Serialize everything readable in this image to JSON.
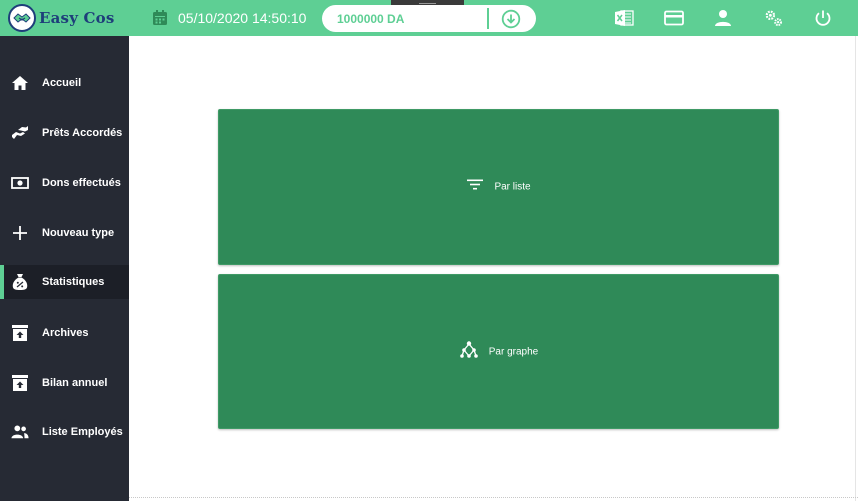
{
  "app": {
    "logo_text": "Easy Cos",
    "datetime": "05/10/2020 14:50:10",
    "balance": "1000000 DA"
  },
  "header_icons": [
    "excel-icon",
    "card-icon",
    "user-icon",
    "settings-icon",
    "power-icon"
  ],
  "sidebar": {
    "items": [
      {
        "label": "Accueil",
        "icon": "home-icon"
      },
      {
        "label": "Prêts Accordés",
        "icon": "loan-icon"
      },
      {
        "label": "Dons effectués",
        "icon": "money-icon"
      },
      {
        "label": "Nouveau type",
        "icon": "plus-icon"
      },
      {
        "label": "Statistiques",
        "icon": "statistics-icon",
        "active": true
      },
      {
        "label": "Archives",
        "icon": "archive-icon"
      },
      {
        "label": "Bilan annuel",
        "icon": "archive-up-icon"
      },
      {
        "label": "Liste Employés",
        "icon": "people-icon"
      }
    ]
  },
  "main": {
    "cards": [
      {
        "label": "Par liste",
        "icon": "filter-list-icon"
      },
      {
        "label": "Par graphe",
        "icon": "graph-icon"
      }
    ]
  },
  "colors": {
    "header": "#5ecf94",
    "sidebar": "#262a34",
    "card": "#2f8a58",
    "logo": "#1e3e7a"
  }
}
